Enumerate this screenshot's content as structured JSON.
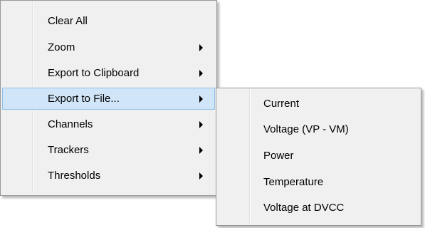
{
  "main_menu": {
    "items": [
      {
        "label": "Clear All",
        "has_submenu": false
      },
      {
        "label": "Zoom",
        "has_submenu": true
      },
      {
        "label": "Export to Clipboard",
        "has_submenu": true
      },
      {
        "label": "Export to File...",
        "has_submenu": true,
        "highlighted": true
      },
      {
        "label": "Channels",
        "has_submenu": true
      },
      {
        "label": "Trackers",
        "has_submenu": true
      },
      {
        "label": "Thresholds",
        "has_submenu": true
      }
    ]
  },
  "sub_menu": {
    "items": [
      {
        "label": "Current"
      },
      {
        "label": "Voltage (VP - VM)"
      },
      {
        "label": "Power"
      },
      {
        "label": "Temperature"
      },
      {
        "label": "Voltage at DVCC"
      }
    ]
  },
  "colors": {
    "menu_background": "#f0f0f0",
    "highlight_background": "#d1e5f8",
    "highlight_border": "#8fbfe8",
    "menu_border": "#979797"
  },
  "icons": {
    "submenu_arrow": "chevron-right-icon"
  }
}
